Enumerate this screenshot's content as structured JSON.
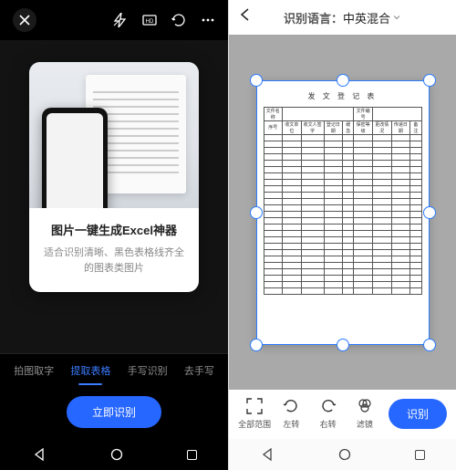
{
  "left": {
    "card": {
      "title": "图片一键生成Excel神器",
      "desc": "适合识别清晰、黑色表格线齐全的图表类图片"
    },
    "tabs": [
      "拍图取字",
      "提取表格",
      "手写识别",
      "去手写"
    ],
    "active_tab_index": 1,
    "action": "立即识别"
  },
  "right": {
    "lang_label": "识别语言：",
    "lang_value": "中英混合",
    "doc_title": "发 文 登 记 表",
    "doc_header1": [
      "文件名称",
      "",
      "",
      "文件编号",
      ""
    ],
    "doc_header2": [
      "序号",
      "收文单位",
      "收文人签字",
      "登记日期",
      "缓急",
      "保密等级",
      "更改情况",
      "传递日期",
      "备注"
    ],
    "tools": {
      "full": "全部范围",
      "rotL": "左转",
      "rotR": "右转",
      "filter": "滤镜"
    },
    "action": "识别"
  }
}
